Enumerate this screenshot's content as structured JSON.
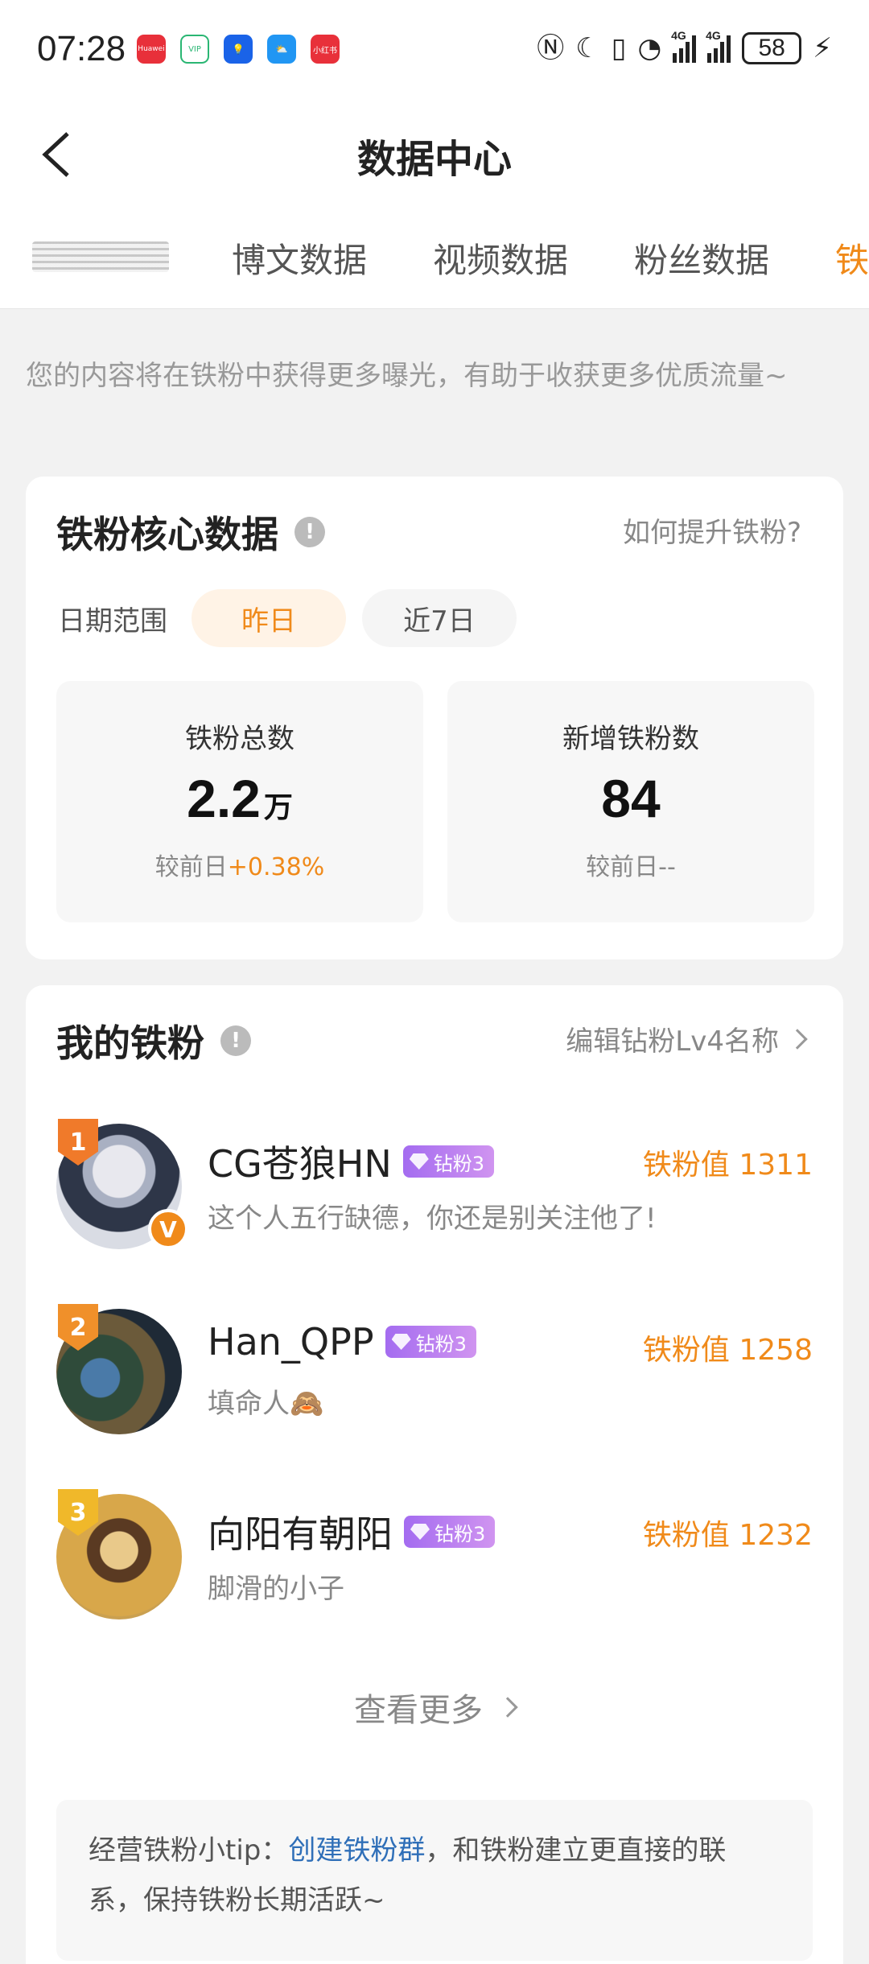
{
  "status_bar": {
    "time": "07:28",
    "battery": "58",
    "notification_icons": [
      "huawei-app-icon",
      "vip-home-icon",
      "bulb-icon",
      "weather-icon",
      "xiaohongshu-icon"
    ],
    "notification_colors": [
      "#e8303a",
      "#2ab673",
      "#1a63e8",
      "#2196f3",
      "#e8303a"
    ],
    "notification_text": [
      "Huawei",
      "VIP",
      "",
      "",
      "小红书"
    ],
    "signal_labels": [
      "4G",
      "4G"
    ]
  },
  "nav": {
    "title": "数据中心"
  },
  "tabs": {
    "items": [
      "博文数据",
      "视频数据",
      "粉丝数据",
      "铁"
    ]
  },
  "intro": "您的内容将在铁粉中获得更多曝光，有助于收获更多优质流量~",
  "core": {
    "title": "铁粉核心数据",
    "how_link": "如何提升铁粉?",
    "date_label": "日期范围",
    "date_options": [
      "昨日",
      "近7日"
    ],
    "total": {
      "label": "铁粉总数",
      "value": "2.2",
      "unit": "万",
      "compare_prefix": "较前日",
      "compare_value": "+0.38%"
    },
    "new": {
      "label": "新增铁粉数",
      "value": "84",
      "compare_prefix": "较前日",
      "compare_value": "--"
    }
  },
  "fans": {
    "title": "我的铁粉",
    "edit_link": "编辑钻粉Lv4名称",
    "list": [
      {
        "rank": "1",
        "name": "CG苍狼HN",
        "badge": "钻粉3",
        "bio": "这个人五行缺德，你还是别关注他了!",
        "score_label": "铁粉值",
        "score": "1311"
      },
      {
        "rank": "2",
        "name": "Han_QPP",
        "badge": "钻粉3",
        "bio": "填命人🙈",
        "score_label": "铁粉值",
        "score": "1258"
      },
      {
        "rank": "3",
        "name": "向阳有朝阳",
        "badge": "钻粉3",
        "bio": "脚滑的小子",
        "score_label": "铁粉值",
        "score": "1232"
      }
    ],
    "see_more": "查看更多",
    "tip_prefix": "经营铁粉小tip：",
    "tip_link": "创建铁粉群",
    "tip_suffix": "，和铁粉建立更直接的联系，保持铁粉长期活跃~"
  },
  "colors": {
    "accent": "#f08a1a",
    "link": "#2f6fb8",
    "diamond": "#b07cf0"
  }
}
